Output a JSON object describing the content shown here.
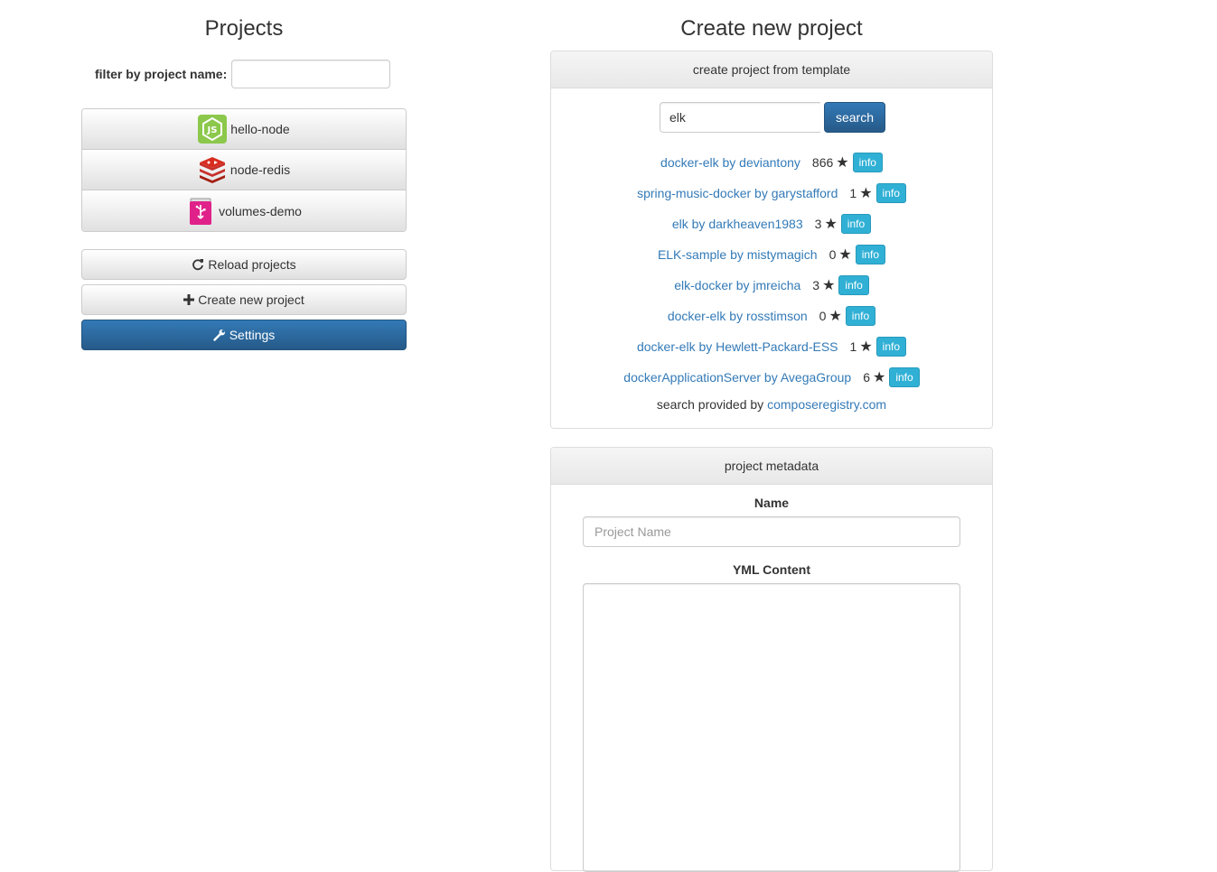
{
  "projects_panel": {
    "title": "Projects",
    "filter_label": "filter by project name:",
    "filter_value": "",
    "items": [
      {
        "name": "hello-node",
        "icon": "nodejs-icon"
      },
      {
        "name": "node-redis",
        "icon": "redis-icon"
      },
      {
        "name": "volumes-demo",
        "icon": "usb-drive-icon"
      }
    ],
    "reload_label": "Reload projects",
    "create_label": "Create new project",
    "settings_label": "Settings"
  },
  "create_panel": {
    "title": "Create new project",
    "template_heading": "create project from template",
    "search_value": "elk",
    "search_button": "search",
    "results": [
      {
        "name": "docker-elk by deviantony",
        "stars": "866",
        "info": "info"
      },
      {
        "name": "spring-music-docker by garystafford",
        "stars": "1",
        "info": "info"
      },
      {
        "name": "elk by darkheaven1983",
        "stars": "3",
        "info": "info"
      },
      {
        "name": "ELK-sample by mistymagich",
        "stars": "0",
        "info": "info"
      },
      {
        "name": "elk-docker by jmreicha",
        "stars": "3",
        "info": "info"
      },
      {
        "name": "docker-elk by rosstimson",
        "stars": "0",
        "info": "info"
      },
      {
        "name": "docker-elk by Hewlett-Packard-ESS",
        "stars": "1",
        "info": "info"
      },
      {
        "name": "dockerApplicationServer by AvegaGroup",
        "stars": "6",
        "info": "info"
      }
    ],
    "provided_by_text": "search provided by",
    "provided_by_link": "composeregistry.com",
    "metadata_heading": "project metadata",
    "name_label": "Name",
    "name_placeholder": "Project Name",
    "name_value": "",
    "yml_label": "YML Content",
    "yml_value": ""
  },
  "colors": {
    "primary": "#337ab7",
    "info": "#31b0d5",
    "link": "#337ab7"
  }
}
